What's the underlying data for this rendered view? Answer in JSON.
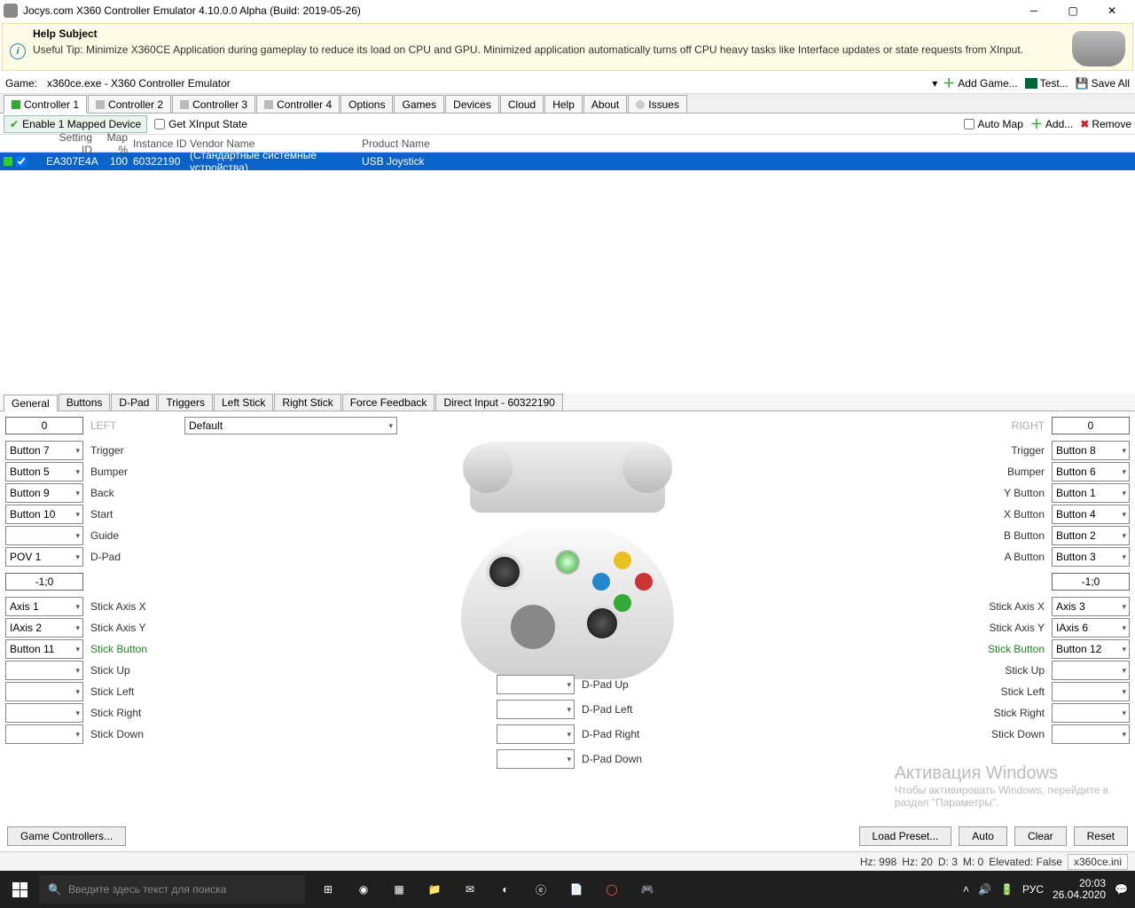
{
  "window": {
    "title": "Jocys.com X360 Controller Emulator 4.10.0.0 Alpha (Build: 2019-05-26)"
  },
  "help": {
    "title": "Help Subject",
    "body": "Useful Tip: Minimize X360CE Application during gameplay to reduce its load on CPU and GPU. Minimized application automatically turns off CPU heavy tasks like Interface updates or state requests from XInput."
  },
  "game_label": "Game:",
  "game_value": "x360ce.exe - X360 Controller Emulator",
  "top_buttons": {
    "add_game": "Add Game...",
    "test": "Test...",
    "save_all": "Save All"
  },
  "main_tabs": [
    "Controller 1",
    "Controller 2",
    "Controller 3",
    "Controller 4",
    "Options",
    "Games",
    "Devices",
    "Cloud",
    "Help",
    "About",
    "Issues"
  ],
  "toolbar": {
    "enable": "Enable 1 Mapped Device",
    "get_state": "Get XInput State",
    "auto_map": "Auto Map",
    "add": "Add...",
    "remove": "Remove"
  },
  "grid": {
    "headers": {
      "setting_id": "Setting ID",
      "map": "Map %",
      "instance": "Instance ID",
      "vendor": "Vendor Name",
      "product": "Product Name"
    },
    "row": {
      "setting_id": "EA307E4A",
      "map": "100",
      "instance": "60322190",
      "vendor": "(Стандартные системные устройства)",
      "product": "USB Joystick"
    }
  },
  "lower_tabs": [
    "General",
    "Buttons",
    "D-Pad",
    "Triggers",
    "Left Stick",
    "Right Stick",
    "Force Feedback",
    "Direct Input - 60322190"
  ],
  "preset": "Default",
  "left_header": {
    "value": "0",
    "label": "LEFT"
  },
  "right_header": {
    "value": "0",
    "label": "RIGHT"
  },
  "left_map": [
    {
      "combo": "Button 7",
      "label": "Trigger"
    },
    {
      "combo": "Button 5",
      "label": "Bumper"
    },
    {
      "combo": "Button 9",
      "label": "Back"
    },
    {
      "combo": "Button 10",
      "label": "Start"
    },
    {
      "combo": "",
      "label": "Guide"
    },
    {
      "combo": "POV 1",
      "label": "D-Pad"
    }
  ],
  "left_coord": "-1;0",
  "left_stick": [
    {
      "combo": "Axis 1",
      "label": "Stick Axis X"
    },
    {
      "combo": "IAxis 2",
      "label": "Stick Axis Y"
    },
    {
      "combo": "Button 11",
      "label": "Stick Button",
      "green": true
    },
    {
      "combo": "",
      "label": "Stick Up"
    },
    {
      "combo": "",
      "label": "Stick Left"
    },
    {
      "combo": "",
      "label": "Stick Right"
    },
    {
      "combo": "",
      "label": "Stick Down"
    }
  ],
  "right_map": [
    {
      "combo": "Button 8",
      "label": "Trigger"
    },
    {
      "combo": "Button 6",
      "label": "Bumper"
    },
    {
      "combo": "Button 1",
      "label": "Y Button"
    },
    {
      "combo": "Button 4",
      "label": "X Button"
    },
    {
      "combo": "Button 2",
      "label": "B Button"
    },
    {
      "combo": "Button 3",
      "label": "A Button"
    }
  ],
  "right_coord": "-1;0",
  "right_stick": [
    {
      "combo": "Axis 3",
      "label": "Stick Axis X"
    },
    {
      "combo": "IAxis 6",
      "label": "Stick Axis Y"
    },
    {
      "combo": "Button 12",
      "label": "Stick Button",
      "green": true
    },
    {
      "combo": "",
      "label": "Stick Up"
    },
    {
      "combo": "",
      "label": "Stick Left"
    },
    {
      "combo": "",
      "label": "Stick Right"
    },
    {
      "combo": "",
      "label": "Stick Down"
    }
  ],
  "dpad": [
    {
      "combo": "",
      "label": "D-Pad Up"
    },
    {
      "combo": "",
      "label": "D-Pad Left"
    },
    {
      "combo": "",
      "label": "D-Pad Right"
    },
    {
      "combo": "",
      "label": "D-Pad Down"
    }
  ],
  "footer": {
    "game_ctrl": "Game Controllers...",
    "load": "Load Preset...",
    "auto": "Auto",
    "clear": "Clear",
    "reset": "Reset"
  },
  "status": {
    "hz1": "Hz: 998",
    "hz2": "Hz: 20",
    "d": "D: 3",
    "m": "M: 0",
    "elev": "Elevated: False",
    "ini": "x360ce.ini"
  },
  "watermark": {
    "l1": "Активация Windows",
    "l2": "Чтобы активировать Windows, перейдите в",
    "l3": "раздел \"Параметры\"."
  },
  "taskbar": {
    "search": "Введите здесь текст для поиска",
    "lang": "РУС",
    "time": "20:03",
    "date": "26.04.2020"
  }
}
